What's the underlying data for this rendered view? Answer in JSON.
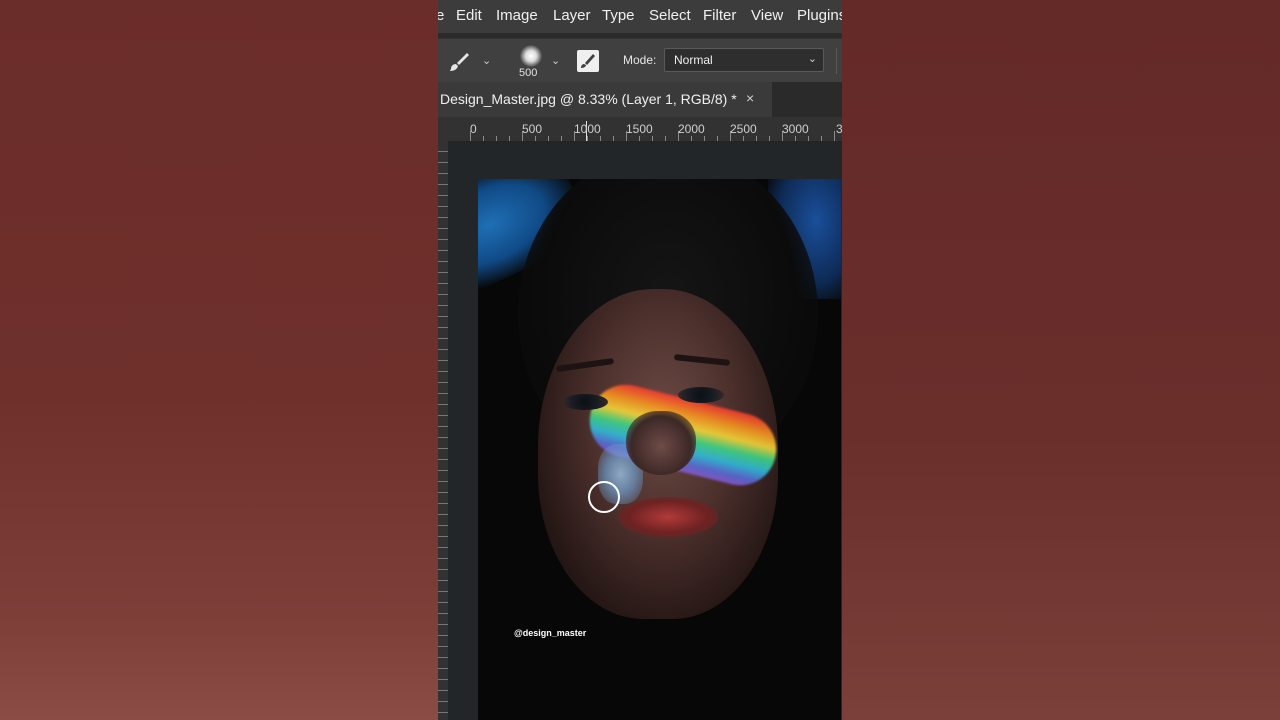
{
  "menu": {
    "items": [
      "e",
      "Edit",
      "Image",
      "Layer",
      "Type",
      "Select",
      "Filter",
      "View",
      "Plugins"
    ]
  },
  "options": {
    "brush_tool_icon": "brush-icon",
    "brush_size": "500",
    "mode_label": "Mode:",
    "mode_value": "Normal"
  },
  "document": {
    "tab_title": "Design_Master.jpg @ 8.33% (Layer 1, RGB/8) *",
    "close_symbol": "×"
  },
  "ruler": {
    "ticks": [
      "0",
      "500",
      "1000",
      "1500",
      "2000",
      "2500",
      "3000",
      "3"
    ]
  },
  "canvas": {
    "watermark": "@design_master"
  },
  "colors": {
    "background": "#6a2e2b",
    "panel": "#2b2b2b",
    "menubar": "#3c3c3c"
  }
}
